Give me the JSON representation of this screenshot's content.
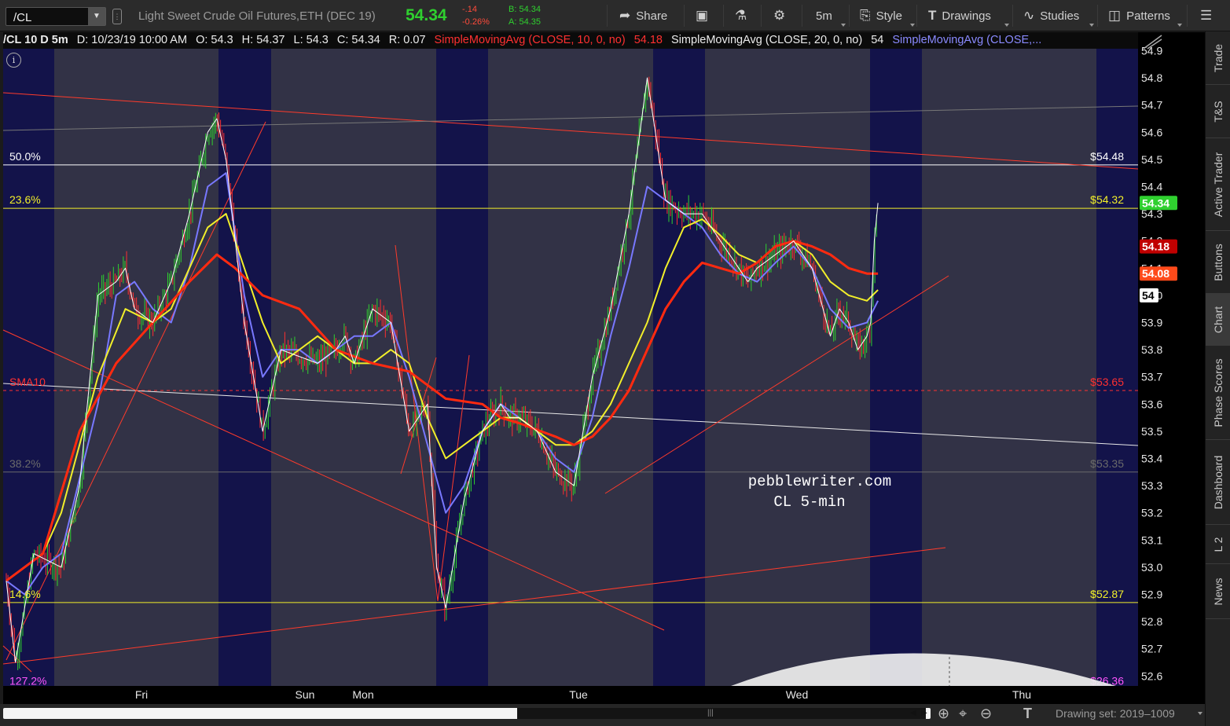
{
  "toolbar": {
    "symbol": "/CL",
    "instrument": "Light Sweet Crude Oil Futures,ETH (DEC 19)",
    "last": "54.34",
    "net_change": "-.14",
    "net_pct": "-0.26%",
    "bid": "B: 54.34",
    "ask": "A: 54.35",
    "share_label": "Share",
    "timeframe_label": "5m",
    "style_label": "Style",
    "drawings_label": "Drawings",
    "studies_label": "Studies",
    "patterns_label": "Patterns"
  },
  "header": {
    "title": "/CL 10 D 5m",
    "date": "D: 10/23/19 10:00 AM",
    "open": "O: 54.3",
    "high": "H: 54.37",
    "low": "L: 54.3",
    "close": "C: 54.34",
    "range": "R: 0.07",
    "sma10_name": "SimpleMovingAvg (CLOSE, 10, 0, no)",
    "sma10_val": "54.18",
    "sma20_name": "SimpleMovingAvg (CLOSE, 20, 0, no)",
    "sma20_val": "54",
    "sma_blue_name": "SimpleMovingAvg (CLOSE,..."
  },
  "side_tabs": [
    "Trade",
    "T&S",
    "Active Trader",
    "Buttons",
    "Chart",
    "Phase Scores",
    "Dashboard",
    "L 2",
    "News"
  ],
  "bottom": {
    "drawing_set": "Drawing set: 2019–1009"
  },
  "colors": {
    "background": "#000000",
    "shade_band": "#323246",
    "night_band": "#13134a",
    "sma_red": "#ff2a10",
    "sma_yellow": "#f2ef2a",
    "sma_blue": "#7878ff",
    "price_up": "#2fd02f",
    "price_down": "#ff3030"
  },
  "chart_data": {
    "type": "line",
    "symbol": "/CL",
    "timeframe": "5m",
    "x_labels": [
      "Fri",
      "Sun",
      "Mon",
      "Tue",
      "Wed",
      "Thu"
    ],
    "y_ticks": [
      54.9,
      54.8,
      54.7,
      54.6,
      54.5,
      54.4,
      54.3,
      54.2,
      54.1,
      54.0,
      53.9,
      53.8,
      53.7,
      53.6,
      53.5,
      53.4,
      53.3,
      53.2,
      53.1,
      53.0,
      52.9,
      52.8,
      52.7,
      52.6
    ],
    "ylim": [
      52.55,
      54.95
    ],
    "price_badges": [
      {
        "label": "54.34",
        "value": 54.34,
        "color": "#2fd02f"
      },
      {
        "label": "54.18",
        "value": 54.18,
        "color": "#c00000"
      },
      {
        "label": "54.08",
        "value": 54.08,
        "color": "#ff4a1a"
      },
      {
        "label": "54",
        "value": 54.0,
        "color": "#ffffff"
      }
    ],
    "fib_levels": [
      {
        "label": "50.0%",
        "price_label": "$54.48",
        "value": 54.48,
        "color": "#ffffff"
      },
      {
        "label": "23.6%",
        "price_label": "$54.32",
        "value": 54.32,
        "color": "#f2ef2a"
      },
      {
        "label": "38.2%",
        "price_label": "$53.35",
        "value": 53.35,
        "color": "#6a6a6a"
      },
      {
        "label": "14.6%",
        "price_label": "$52.87",
        "value": 52.87,
        "color": "#f2ef2a"
      },
      {
        "label": "127.2%",
        "price_label": "$26.36",
        "value": 52.55,
        "color": "#ff55ff"
      }
    ],
    "horizontal_line": {
      "label": "SMA10",
      "price_label": "$53.65",
      "value": 53.65,
      "color": "#ff3030",
      "dashed": true
    },
    "annotation": [
      "pebblewriter.com",
      "CL 5-min"
    ],
    "series": [
      {
        "name": "Price",
        "color": "#ffffff",
        "x": [
          0,
          0.5,
          1.5,
          3,
          4,
          5,
          6,
          6.5,
          7,
          8,
          9,
          10,
          11,
          11.5,
          12,
          12.5,
          13,
          14,
          15,
          17,
          18,
          18.5,
          19,
          20,
          21,
          22,
          23,
          23.5,
          24,
          25,
          26,
          27,
          27.5,
          28,
          29,
          30,
          31,
          32,
          33,
          34,
          35,
          36,
          37,
          38,
          39,
          40,
          40.5,
          41,
          42,
          43,
          44,
          45,
          45.5,
          46,
          46.5,
          47,
          47.2,
          47.4,
          47.6
        ],
        "values": [
          52.95,
          52.65,
          53.05,
          53.0,
          53.3,
          54.0,
          54.05,
          54.1,
          53.95,
          53.9,
          54.05,
          54.3,
          54.6,
          54.65,
          54.5,
          54.2,
          53.9,
          53.5,
          53.8,
          53.75,
          53.8,
          53.85,
          53.75,
          53.95,
          53.9,
          53.5,
          53.6,
          53.0,
          52.85,
          53.25,
          53.5,
          53.6,
          53.55,
          53.55,
          53.5,
          53.35,
          53.3,
          53.7,
          53.95,
          54.3,
          54.8,
          54.35,
          54.3,
          54.3,
          54.2,
          54.1,
          54.05,
          54.1,
          54.15,
          54.2,
          54.1,
          53.85,
          53.95,
          53.9,
          53.8,
          53.85,
          53.9,
          54.2,
          54.34
        ]
      },
      {
        "name": "SimpleMovingAvg (CLOSE, 10, 0, no)",
        "color": "#ff2a10",
        "x": [
          0,
          2,
          4,
          6,
          8,
          10,
          11.5,
          12.5,
          14,
          16,
          18,
          20,
          22,
          24,
          26,
          27,
          28,
          30,
          31,
          32,
          33,
          34,
          35,
          36,
          37,
          38,
          39,
          40,
          41,
          42,
          43,
          44,
          45,
          46,
          47,
          47.6
        ],
        "values": [
          52.95,
          53.05,
          53.5,
          53.75,
          53.9,
          54.05,
          54.15,
          54.1,
          54.0,
          53.95,
          53.8,
          53.75,
          53.72,
          53.62,
          53.6,
          53.55,
          53.53,
          53.48,
          53.45,
          53.48,
          53.55,
          53.65,
          53.8,
          53.95,
          54.05,
          54.12,
          54.1,
          54.08,
          54.12,
          54.18,
          54.2,
          54.18,
          54.15,
          54.1,
          54.08,
          54.08
        ]
      },
      {
        "name": "SimpleMovingAvg (CLOSE, 20, 0, no)",
        "color": "#f2ef2a",
        "x": [
          0,
          1,
          2,
          3,
          5,
          6.5,
          8,
          9,
          10,
          11,
          12,
          13,
          14,
          15,
          16,
          17,
          18,
          19,
          20,
          21,
          22,
          23,
          24,
          25,
          26,
          27,
          28,
          29,
          30,
          31,
          32,
          33,
          34,
          35,
          36,
          37,
          38,
          39,
          40,
          41,
          42,
          43,
          44,
          45,
          46,
          47,
          47.6
        ],
        "values": [
          52.95,
          53.0,
          53.05,
          53.2,
          53.7,
          53.95,
          53.9,
          53.95,
          54.1,
          54.25,
          54.3,
          54.1,
          53.9,
          53.75,
          53.8,
          53.85,
          53.8,
          53.75,
          53.75,
          53.8,
          53.75,
          53.55,
          53.4,
          53.45,
          53.5,
          53.55,
          53.55,
          53.5,
          53.45,
          53.45,
          53.5,
          53.6,
          53.75,
          53.9,
          54.1,
          54.25,
          54.28,
          54.22,
          54.15,
          54.12,
          54.18,
          54.2,
          54.15,
          54.05,
          54.0,
          53.98,
          54.02
        ]
      },
      {
        "name": "SimpleMovingAvg (CLOSE,...",
        "color": "#7878ff",
        "x": [
          0,
          1,
          2,
          3,
          5,
          6,
          7,
          8,
          9,
          10,
          11,
          12,
          13,
          14,
          15,
          16,
          17,
          18,
          19,
          20,
          21,
          22,
          23,
          24,
          25,
          26,
          27,
          28,
          29,
          30,
          31,
          32,
          33,
          34,
          35,
          36,
          37,
          38,
          39,
          40,
          41,
          42,
          43,
          44,
          45,
          46,
          47,
          47.6
        ],
        "values": [
          52.95,
          52.9,
          53.0,
          53.05,
          53.6,
          54.0,
          54.05,
          53.95,
          53.9,
          54.1,
          54.4,
          54.45,
          54.0,
          53.7,
          53.8,
          53.8,
          53.75,
          53.8,
          53.85,
          53.85,
          53.9,
          53.7,
          53.45,
          53.2,
          53.3,
          53.5,
          53.6,
          53.55,
          53.5,
          53.4,
          53.35,
          53.55,
          53.85,
          54.1,
          54.4,
          54.35,
          54.3,
          54.25,
          54.15,
          54.08,
          54.05,
          54.12,
          54.18,
          54.1,
          53.95,
          53.88,
          53.9,
          53.98
        ]
      }
    ]
  }
}
